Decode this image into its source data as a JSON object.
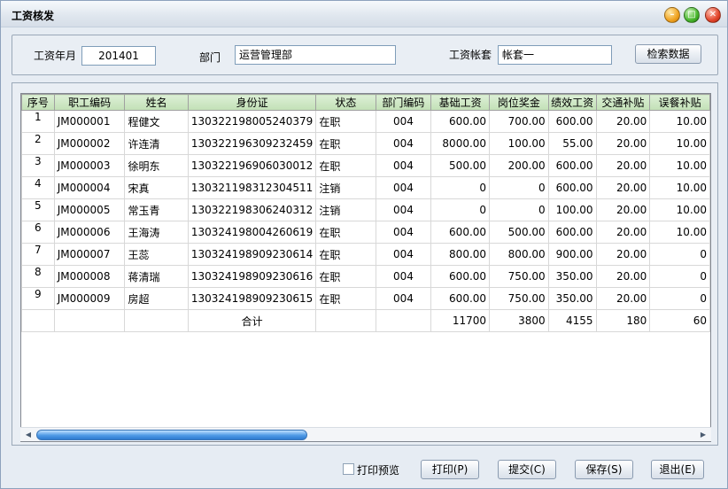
{
  "window": {
    "title": "工资核发"
  },
  "filter": {
    "year_month_label": "工资年月",
    "year_month_value": "201401",
    "dept_label": "部门",
    "dept_value": "运营管理部",
    "account_label": "工资帐套",
    "account_value": "帐套一",
    "search_button": "检索数据"
  },
  "table": {
    "headers": [
      "序号",
      "职工编码",
      "姓名",
      "身份证",
      "状态",
      "部门编码",
      "基础工资",
      "岗位奖金",
      "绩效工资",
      "交通补贴",
      "误餐补贴"
    ],
    "rows": [
      [
        "1",
        "JM000001",
        "程健文",
        "130322198005240379",
        "在职",
        "004",
        "600.00",
        "700.00",
        "600.00",
        "20.00",
        "10.00"
      ],
      [
        "2",
        "JM000002",
        "许连清",
        "130322196309232459",
        "在职",
        "004",
        "8000.00",
        "100.00",
        "55.00",
        "20.00",
        "10.00"
      ],
      [
        "3",
        "JM000003",
        "徐明东",
        "130322196906030012",
        "在职",
        "004",
        "500.00",
        "200.00",
        "600.00",
        "20.00",
        "10.00"
      ],
      [
        "4",
        "JM000004",
        "宋真",
        "130321198312304511",
        "注销",
        "004",
        "0",
        "0",
        "600.00",
        "20.00",
        "10.00"
      ],
      [
        "5",
        "JM000005",
        "常玉青",
        "130322198306240312",
        "注销",
        "004",
        "0",
        "0",
        "100.00",
        "20.00",
        "10.00"
      ],
      [
        "6",
        "JM000006",
        "王海涛",
        "130324198004260619",
        "在职",
        "004",
        "600.00",
        "500.00",
        "600.00",
        "20.00",
        "10.00"
      ],
      [
        "7",
        "JM000007",
        "王蕊",
        "130324198909230614",
        "在职",
        "004",
        "800.00",
        "800.00",
        "900.00",
        "20.00",
        "0"
      ],
      [
        "8",
        "JM000008",
        "蒋清瑞",
        "130324198909230616",
        "在职",
        "004",
        "600.00",
        "750.00",
        "350.00",
        "20.00",
        "0"
      ],
      [
        "9",
        "JM000009",
        "房超",
        "130324198909230615",
        "在职",
        "004",
        "600.00",
        "750.00",
        "350.00",
        "20.00",
        "0"
      ]
    ],
    "total_row": [
      "",
      "",
      "",
      "合计",
      "",
      "",
      "11700",
      "3800",
      "4155",
      "180",
      "60"
    ]
  },
  "footer": {
    "print_preview_label": "打印预览",
    "print_button": "打印(P)",
    "submit_button": "提交(C)",
    "save_button": "保存(S)",
    "exit_button": "退出(E)"
  }
}
